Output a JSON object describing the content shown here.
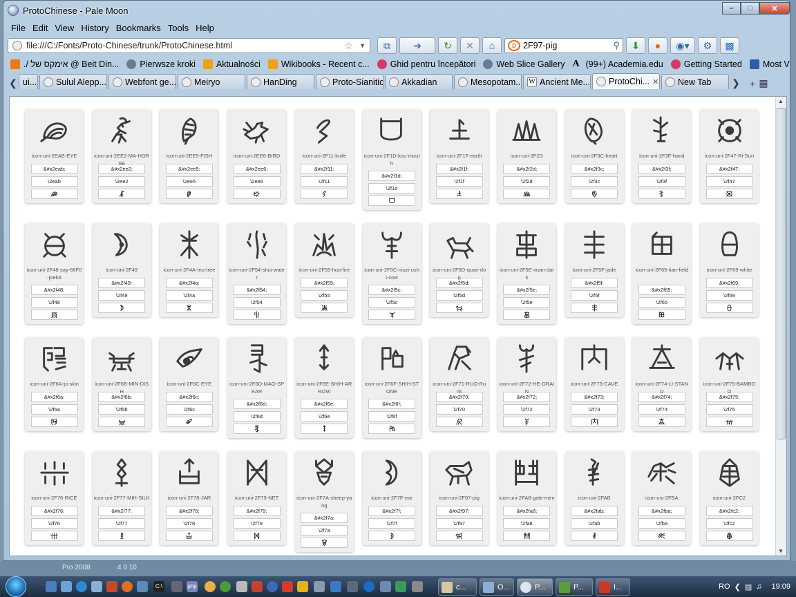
{
  "window": {
    "title": "ProtoChinese - Pale Moon"
  },
  "menu": [
    "File",
    "Edit",
    "View",
    "History",
    "Bookmarks",
    "Tools",
    "Help"
  ],
  "url": "file:///C:/Fonts/Proto-Chinese/trunk/ProtoChinese.html",
  "search": {
    "value": "2F97-pig"
  },
  "bookmarks": [
    {
      "label": "./ אימקס של @ Beit Din...",
      "color": "#e77b1a"
    },
    {
      "label": "Pierwsze kroki",
      "color": "#6a7d90"
    },
    {
      "label": "Aktualności",
      "color": "#f0a020"
    },
    {
      "label": "Wikibooks - Recent c...",
      "color": "#f0a020"
    },
    {
      "label": "Ghid pentru începători",
      "color": "#d23a6a"
    },
    {
      "label": "Web Slice Gallery",
      "color": "#6a7d90"
    },
    {
      "label": "(99+) Academia.edu",
      "color": "#000000"
    },
    {
      "label": "Getting Started",
      "color": "#d23a6a"
    },
    {
      "label": "Most Visited",
      "color": "#2a5fa8"
    }
  ],
  "tabs": [
    {
      "label": "ui...",
      "active": false
    },
    {
      "label": "Sulul Alepp...",
      "active": false
    },
    {
      "label": "Webfont ge...",
      "active": false
    },
    {
      "label": "Meiryo",
      "active": false
    },
    {
      "label": "HanDing",
      "active": false
    },
    {
      "label": "Proto-Sianitic",
      "active": false
    },
    {
      "label": "Akkadian",
      "active": false
    },
    {
      "label": "Mesopotam...",
      "active": false
    },
    {
      "label": "Ancient Me...",
      "active": false
    },
    {
      "label": "ProtoChi...",
      "active": true
    },
    {
      "label": "New Tab",
      "active": false
    }
  ],
  "glyphs": [
    [
      {
        "name": "icon-uni-2EAB-EYE",
        "entity": "&#x2eab;",
        "css": "\\2eab",
        "icon": "shell"
      },
      {
        "name": "icon-uni-2EE2-MA-HORSE",
        "entity": "&#x2ee2;",
        "css": "\\2ee2",
        "icon": "horse"
      },
      {
        "name": "icon-uni-2EE5-FISH",
        "entity": "&#x2ee5;",
        "css": "\\2ee5",
        "icon": "fish"
      },
      {
        "name": "icon-uni-2EE6-BIRD",
        "entity": "&#x2ee6;",
        "css": "\\2ee6",
        "icon": "bird"
      },
      {
        "name": "icon-uni-2F11-knife",
        "entity": "&#x2f11;",
        "css": "\\2f11",
        "icon": "knife"
      },
      {
        "name": "icon-uni-2F1D-kou-mouth",
        "entity": "&#x2f1d;",
        "css": "\\2f1d",
        "icon": "mouth"
      },
      {
        "name": "icon-uni-2F1F-earth",
        "entity": "&#x2f1f;",
        "css": "\\2f1f",
        "icon": "earth"
      },
      {
        "name": "icon-uni-2F2D",
        "entity": "&#x2f2d;",
        "css": "\\2f2d",
        "icon": "mountain"
      },
      {
        "name": "icon-uni-2F3C-heart",
        "entity": "&#x2f3c;",
        "css": "\\2f3c",
        "icon": "heart"
      },
      {
        "name": "icon-uni-2F3F-hand",
        "entity": "&#x2f3f;",
        "css": "\\2f3f",
        "icon": "hand"
      },
      {
        "name": "icon-uni-2F47-Ri-Sun",
        "entity": "&#x2f47;",
        "css": "\\2f47",
        "icon": "sun"
      }
    ],
    [
      {
        "name": "icon-uni-2F48-say-66F0-joek6",
        "entity": "&#x2f48;",
        "css": "\\2f48",
        "icon": "say"
      },
      {
        "name": "icon-uni-2F49",
        "entity": "&#x2f49;",
        "css": "\\2f49",
        "icon": "moon"
      },
      {
        "name": "icon-uni-2F4A-mu-tree",
        "entity": "&#x2f4a;",
        "css": "\\2f4a",
        "icon": "tree"
      },
      {
        "name": "icon-uni-2F54-shui-water",
        "entity": "&#x2f54;",
        "css": "\\2f54",
        "icon": "water"
      },
      {
        "name": "icon-uni-2F55-huo-fire",
        "entity": "&#x2f55;",
        "css": "\\2f55",
        "icon": "fire"
      },
      {
        "name": "icon-uni-2F5C-niuzi-ushi-cow",
        "entity": "&#x2f5c;",
        "css": "\\2f5c",
        "icon": "cow"
      },
      {
        "name": "icon-uni-2F5D-quan-dog",
        "entity": "&#x2f5d;",
        "css": "\\2f5d",
        "icon": "dog"
      },
      {
        "name": "icon-uni-2F5E-xuan-dark",
        "entity": "&#x2f5e;",
        "css": "\\2f5e",
        "icon": "dark"
      },
      {
        "name": "icon-uni-2F5F-jade",
        "entity": "&#x2f5f;",
        "css": "\\2f5f",
        "icon": "jade"
      },
      {
        "name": "icon-uni-2F65-tian-field",
        "entity": "&#x2f65;",
        "css": "\\2f65",
        "icon": "field"
      },
      {
        "name": "icon-uni-2F69-white",
        "entity": "&#x2f69;",
        "css": "\\2f69",
        "icon": "white"
      }
    ],
    [
      {
        "name": "icon-uni-2F6A-pi-skin",
        "entity": "&#x2f6a;",
        "css": "\\2f6a",
        "icon": "skin"
      },
      {
        "name": "icon-uni-2F6B-MIN-DISH",
        "entity": "&#x2f6b;",
        "css": "\\2f6b",
        "icon": "dish"
      },
      {
        "name": "icon-uni-2F6C-EYE",
        "entity": "&#x2f6c;",
        "css": "\\2f6c",
        "icon": "eye"
      },
      {
        "name": "icon-uni-2F6D-MAO-SPEAR",
        "entity": "&#x2f6d;",
        "css": "\\2f6d",
        "icon": "spear"
      },
      {
        "name": "icon-uni-2F6E-SHIH-ARROW",
        "entity": "&#x2f6e;",
        "css": "\\2f6e",
        "icon": "arrow"
      },
      {
        "name": "icon-uni-2F6F-SHIH-STONE",
        "entity": "&#x2f6f;",
        "css": "\\2f6f",
        "icon": "stone"
      },
      {
        "name": "icon-uni-2F71-RUO-Runk",
        "entity": "&#x2f70;",
        "css": "\\2f70",
        "icon": "runk"
      },
      {
        "name": "icon-uni-2F72-HE-GRAIN",
        "entity": "&#x2f72;",
        "css": "\\2f72",
        "icon": "grain"
      },
      {
        "name": "icon-uni-2F73-CAVE",
        "entity": "&#x2f73;",
        "css": "\\2f73",
        "icon": "cave"
      },
      {
        "name": "icon-uni-2F74-LI-STAND",
        "entity": "&#x2f74;",
        "css": "\\2f74",
        "icon": "stand"
      },
      {
        "name": "icon-uni-2F75-BAMBOO",
        "entity": "&#x2f75;",
        "css": "\\2f75",
        "icon": "bamboo"
      }
    ],
    [
      {
        "name": "icon-uni-2F76-RICE",
        "entity": "&#x2f76;",
        "css": "\\2f76",
        "icon": "rice"
      },
      {
        "name": "icon-uni-2F77-MIH-SILK",
        "entity": "&#x2f77;",
        "css": "\\2f77",
        "icon": "silk"
      },
      {
        "name": "icon-uni-2F78-JAR",
        "entity": "&#x2f78;",
        "css": "\\2f78",
        "icon": "jar"
      },
      {
        "name": "icon-uni-2F79-NET",
        "entity": "&#x2f79;",
        "css": "\\2f79",
        "icon": "net"
      },
      {
        "name": "icon-uni-2F7A-sheep-yang",
        "entity": "&#x2f7a;",
        "css": "\\2f7a",
        "icon": "sheep"
      },
      {
        "name": "icon-uni-2F7F-ear",
        "entity": "&#x2f7f;",
        "css": "\\2f7f",
        "icon": "ear"
      },
      {
        "name": "icon-uni-2F97-pig",
        "entity": "&#x2f97;",
        "css": "\\2f97",
        "icon": "pig"
      },
      {
        "name": "icon-uni-2FA8-gate-men",
        "entity": "&#x2fa8;",
        "css": "\\2fa8",
        "icon": "gate"
      },
      {
        "name": "icon-uni-2FAB",
        "entity": "&#x2fab;",
        "css": "\\2fab",
        "icon": "fab"
      },
      {
        "name": "icon-uni-2FBA",
        "entity": "&#x2fba;",
        "css": "\\2fba",
        "icon": "fba"
      },
      {
        "name": "icon-uni-2FC2",
        "entity": "&#x2fc2;",
        "css": "\\2fc2",
        "icon": "fc2"
      }
    ]
  ],
  "desktop_strip": {
    "left": "Pro 2008",
    "mid": "4 0 10"
  },
  "taskbar": {
    "tasks": [
      "c...",
      "O...",
      "P...",
      "P...",
      "I..."
    ],
    "lang": "RO",
    "clock": "19:09"
  },
  "colors": {
    "glyph": "#3a3a3a",
    "card_bg": "#efefef",
    "accent": "#2a5fa8"
  }
}
